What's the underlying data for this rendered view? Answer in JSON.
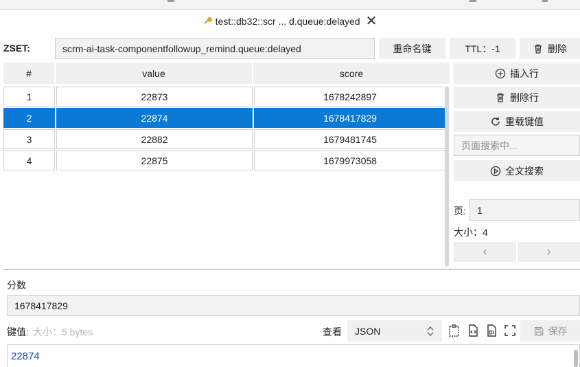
{
  "tab": {
    "title": "test::db32::scr ... d.queue:delayed",
    "close": "✕"
  },
  "key": {
    "type_label": "ZSET:",
    "name": "scrm-ai-task-componentfollowup_remind.queue:delayed"
  },
  "toolbar": {
    "rename_label": "重命名键",
    "ttl_label": "TTL：-1",
    "delete_label": "删除"
  },
  "table": {
    "headers": [
      "#",
      "value",
      "score"
    ],
    "rows": [
      {
        "index": "1",
        "value": "22873",
        "score": "1678242897"
      },
      {
        "index": "2",
        "value": "22874",
        "score": "1678417829"
      },
      {
        "index": "3",
        "value": "22882",
        "score": "1679481745"
      },
      {
        "index": "4",
        "value": "22875",
        "score": "1679973058"
      }
    ],
    "selected_row": 2
  },
  "side": {
    "insert_row": "插入行",
    "delete_row": "删除行",
    "reload": "重载键值",
    "search_placeholder": "页面搜索中...",
    "fulltext": "全文搜索",
    "page_label": "页:",
    "page_value": "1",
    "size_label": "大小：4",
    "prev": "‹",
    "next": "›"
  },
  "score_section": {
    "label": "分数",
    "value": "1678417829"
  },
  "value_section": {
    "label": "键值:",
    "size_hint": "大小：5 bytes",
    "view_label": "查看",
    "format": "JSON",
    "save_label": "保存",
    "content": "22874"
  },
  "colors": {
    "selection": "#0a7ad6",
    "value_text": "#1a3fa8"
  }
}
